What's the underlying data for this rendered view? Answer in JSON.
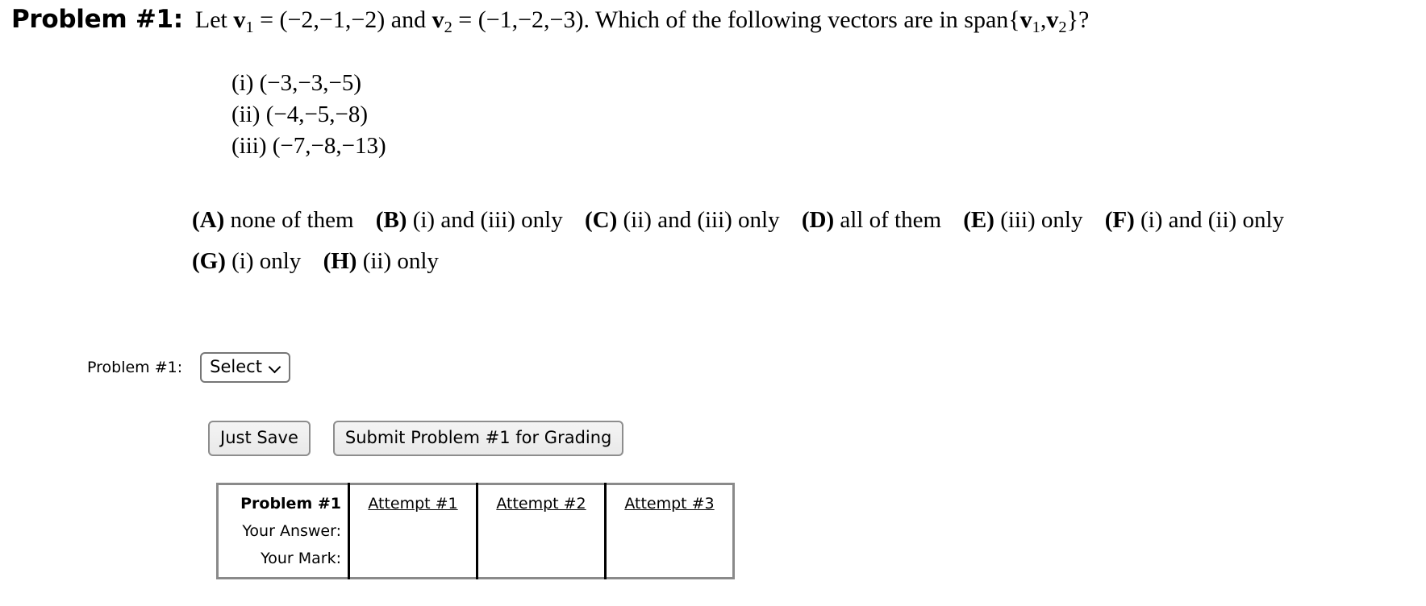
{
  "problem": {
    "label": "Problem #1:",
    "statement_plain": "Let v₁ = (−2, −1, −2) and v₂ = (−1, −2, −3). Which of the following vectors are in span{v₁, v₂}?",
    "intro_word": "Let",
    "v1_name": "v",
    "v1_sub": "1",
    "equals": "=",
    "v1_value": "(−2,−1,−2)",
    "and_word": "and",
    "v2_name": "v",
    "v2_sub": "2",
    "v2_value": "(−1,−2,−3).",
    "question_text": "Which of the following vectors are in span{",
    "span_v1": "v",
    "span_v1_sub": "1",
    "span_comma": ",",
    "span_v2": "v",
    "span_v2_sub": "2",
    "span_close": "}?"
  },
  "vectors": [
    {
      "marker": "(i)",
      "value": "(−3,−3,−5)"
    },
    {
      "marker": "(ii)",
      "value": "(−4,−5,−8)"
    },
    {
      "marker": "(iii)",
      "value": "(−7,−8,−13)"
    }
  ],
  "choices_row1": [
    {
      "key": "(A)",
      "text": "none of them"
    },
    {
      "key": "(B)",
      "text": "(i) and (iii) only"
    },
    {
      "key": "(C)",
      "text": "(ii) and (iii) only"
    },
    {
      "key": "(D)",
      "text": "all of them"
    },
    {
      "key": "(E)",
      "text": "(iii) only"
    },
    {
      "key": "(F)",
      "text": "(i) and (ii) only"
    }
  ],
  "choices_row2": [
    {
      "key": "(G)",
      "text": "(i) only"
    },
    {
      "key": "(H)",
      "text": "(ii) only"
    }
  ],
  "answer_form": {
    "label": "Problem #1:",
    "select_value": "Select",
    "select_icon": "chevron-down-icon"
  },
  "buttons": {
    "just_save": "Just Save",
    "submit": "Submit Problem #1 for Grading"
  },
  "results_table": {
    "row_labels": [
      "Problem #1",
      "Your Answer:",
      "Your Mark:"
    ],
    "attempt_headers": [
      "Attempt #1",
      "Attempt #2",
      "Attempt #3"
    ],
    "cells": [
      [
        "",
        "",
        ""
      ],
      [
        "",
        "",
        ""
      ]
    ]
  }
}
